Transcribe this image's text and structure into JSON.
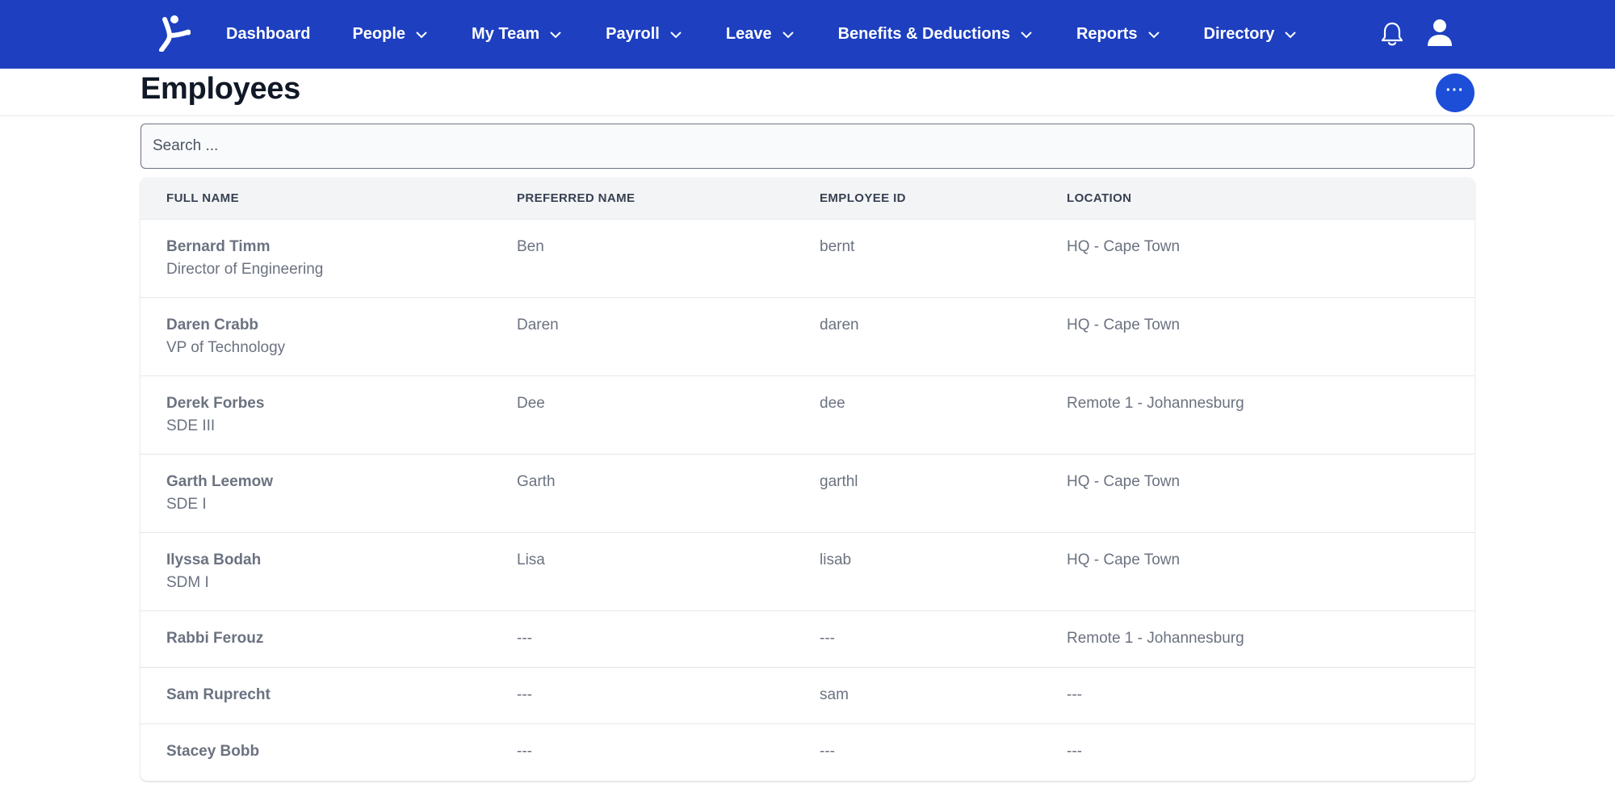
{
  "nav": {
    "items": [
      {
        "label": "Dashboard",
        "dropdown": false
      },
      {
        "label": "People",
        "dropdown": true
      },
      {
        "label": "My Team",
        "dropdown": true
      },
      {
        "label": "Payroll",
        "dropdown": true
      },
      {
        "label": "Leave",
        "dropdown": true
      },
      {
        "label": "Benefits & Deductions",
        "dropdown": true
      },
      {
        "label": "Reports",
        "dropdown": true
      },
      {
        "label": "Directory",
        "dropdown": true
      }
    ],
    "icons": [
      "logo-icon",
      "bell-icon",
      "user-icon"
    ]
  },
  "header": {
    "title": "Employees",
    "more_label": "···"
  },
  "search": {
    "placeholder": "Search ...",
    "value": ""
  },
  "table": {
    "columns": [
      "FULL NAME",
      "PREFERRED NAME",
      "EMPLOYEE ID",
      "LOCATION"
    ],
    "rows": [
      {
        "name": "Bernard Timm",
        "title": "Director of Engineering",
        "preferred": "Ben",
        "id": "bernt",
        "location": "HQ - Cape Town"
      },
      {
        "name": "Daren Crabb",
        "title": "VP of Technology",
        "preferred": "Daren",
        "id": "daren",
        "location": "HQ - Cape Town"
      },
      {
        "name": "Derek Forbes",
        "title": "SDE III",
        "preferred": "Dee",
        "id": "dee",
        "location": "Remote 1 - Johannesburg"
      },
      {
        "name": "Garth Leemow",
        "title": "SDE I",
        "preferred": "Garth",
        "id": "garthl",
        "location": "HQ - Cape Town"
      },
      {
        "name": "Ilyssa Bodah",
        "title": "SDM I",
        "preferred": "Lisa",
        "id": "lisab",
        "location": "HQ - Cape Town"
      },
      {
        "name": "Rabbi Ferouz",
        "title": "",
        "preferred": "---",
        "id": "---",
        "location": "Remote 1 - Johannesburg"
      },
      {
        "name": "Sam Ruprecht",
        "title": "",
        "preferred": "---",
        "id": "sam",
        "location": "---"
      },
      {
        "name": "Stacey Bobb",
        "title": "",
        "preferred": "---",
        "id": "---",
        "location": "---"
      }
    ]
  },
  "colors": {
    "nav_bg": "#1d3fc0",
    "accent": "#1d4ed8",
    "header_row_bg": "#f3f4f6",
    "muted_text": "#6b7280"
  }
}
